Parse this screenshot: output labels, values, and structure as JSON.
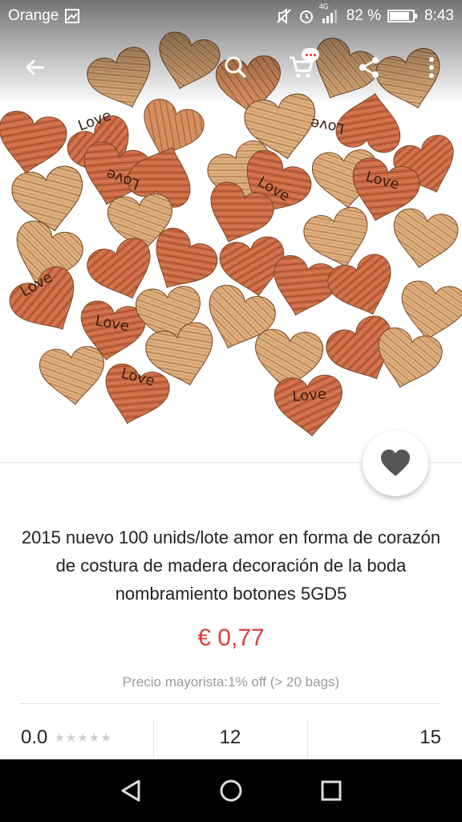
{
  "status_bar": {
    "carrier": "Orange",
    "network": "4G",
    "battery": "82 %",
    "time": "8:43"
  },
  "toolbar": {
    "icons": [
      "back-arrow-icon",
      "search-icon",
      "cart-icon",
      "share-icon",
      "more-vert-icon"
    ]
  },
  "product": {
    "image_alt_words": [
      "Love",
      "Love",
      "Love",
      "Love",
      "Love",
      "Love",
      "Love",
      "Love",
      "Love"
    ],
    "title": "2015 nuevo 100 unids/lote amor en forma de corazón de costura de madera decoración de la boda nombramiento botones 5GD5",
    "price": "€ 0,77",
    "wholesale": "Precio mayorista:1% off (> 20 bags)"
  },
  "stats": {
    "rating": "0.0",
    "stars": 0,
    "orders": "12",
    "wishlist": "15"
  },
  "colors": {
    "price": "#d7403a",
    "heart_light": "#d9a877",
    "heart_red": "#c8633f"
  }
}
